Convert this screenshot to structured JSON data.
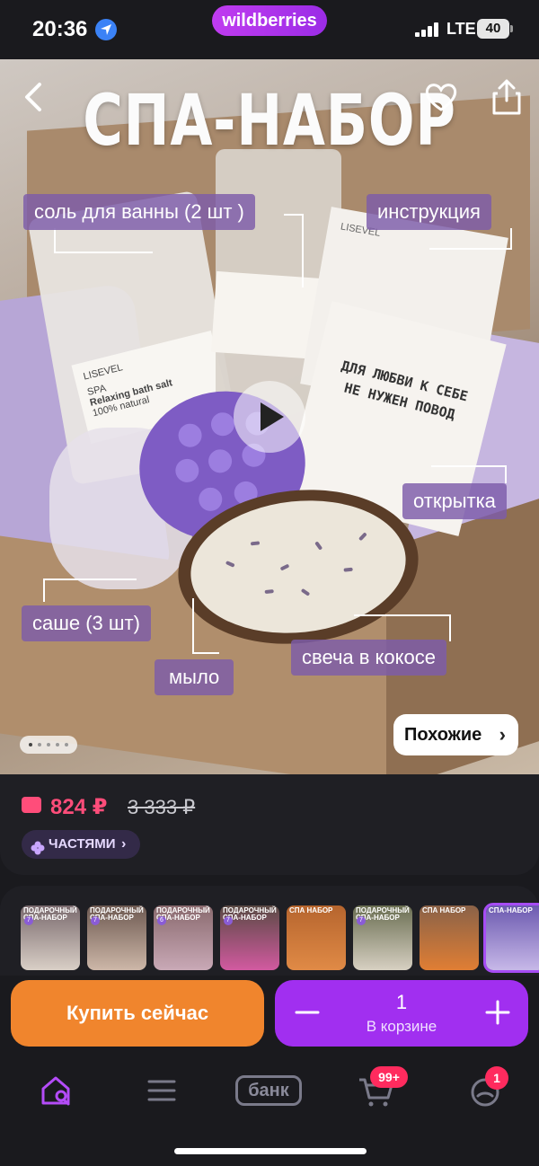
{
  "status_bar": {
    "time": "20:36",
    "network": "LTE",
    "battery": "40",
    "app_logo": "wildberries"
  },
  "hero": {
    "title": "СПА-НАБОР",
    "labels": {
      "bath_salt": "соль для ванны (2 шт )",
      "instructions": "инструкция",
      "postcard": "открытка",
      "sachet": "саше (3 шт)",
      "soap": "мыло",
      "candle": "свеча в кокосе"
    },
    "product_print": {
      "brand": "LISEVEL",
      "salt_line1": "SPA",
      "salt_line2": "Relaxing bath salt",
      "salt_line3": "100% natural",
      "card_text": "ДЛЯ ЛЮБВИ К СЕБЕ НЕ НУЖЕН ПОВОД"
    },
    "similar_label": "Похожие",
    "pager": {
      "count": 5,
      "active": 1
    }
  },
  "price": {
    "current": "824 ₽",
    "old": "3 333 ₽",
    "installments_label": "ЧАСТЯМИ"
  },
  "thumbnails": [
    {
      "title": "ПОДАРОЧНЫЙ СПА-НАБОР",
      "badge": "7",
      "colors": [
        "#7a6a6e",
        "#d9cfc6"
      ]
    },
    {
      "title": "ПОДАРОЧНЫЙ СПА-НАБОР",
      "badge": "7",
      "colors": [
        "#6e5a52",
        "#cdb7a8"
      ]
    },
    {
      "title": "ПОДАРОЧНЫЙ СПА-НАБОР",
      "badge": "6",
      "colors": [
        "#8a6a6e",
        "#c9a9b6"
      ]
    },
    {
      "title": "ПОДАРОЧНЫЙ СПА-НАБОР",
      "badge": "7",
      "colors": [
        "#5a4a44",
        "#d25aa0"
      ]
    },
    {
      "title": "СПА НАБОР",
      "badge": "",
      "colors": [
        "#b6652e",
        "#e08a46"
      ]
    },
    {
      "title": "ПОДАРОЧНЫЙ СПА-НАБОР",
      "badge": "7",
      "colors": [
        "#6a6e52",
        "#d7d0c2"
      ]
    },
    {
      "title": "СПА НАБОР",
      "badge": "",
      "colors": [
        "#8a6248",
        "#e07e34"
      ]
    },
    {
      "title": "СПА-НАБОР",
      "badge": "",
      "colors": [
        "#6c5ab0",
        "#c7b8e8"
      ]
    }
  ],
  "actions": {
    "buy_now": "Купить сейчас",
    "cart_quantity": "1",
    "in_cart_label": "В корзине"
  },
  "nav": {
    "bank_label": "банк",
    "cart_badge": "99+",
    "profile_badge": "1"
  },
  "colors": {
    "accent_purple": "#a12ff0",
    "buy_orange": "#f0852d",
    "price_pink": "#ff4d7a",
    "background": "#1a1a1e"
  }
}
